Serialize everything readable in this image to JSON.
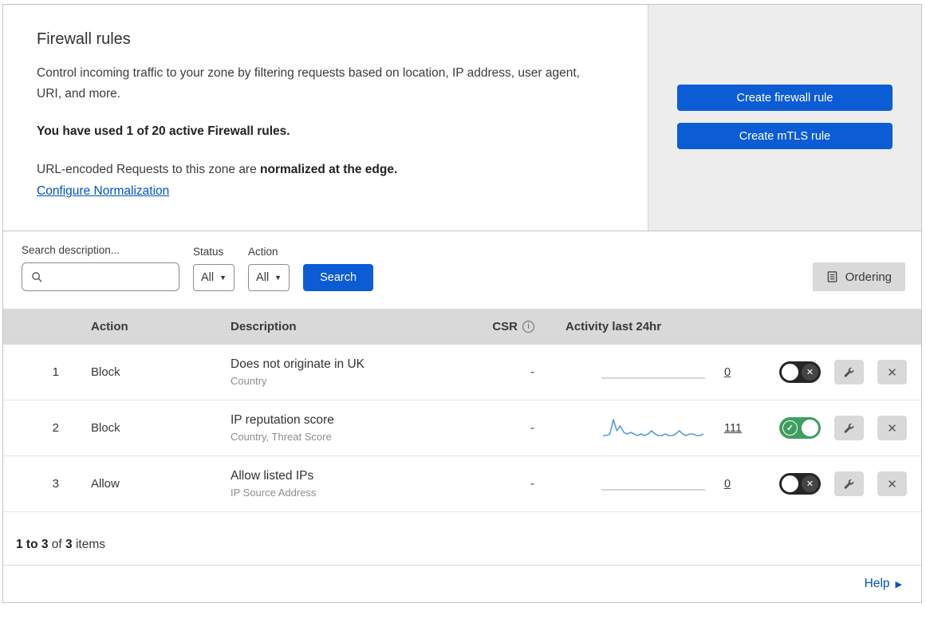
{
  "header": {
    "title": "Firewall rules",
    "description": "Control incoming traffic to your zone by filtering requests based on location, IP address, user agent, URI, and more.",
    "usage": "You have used 1 of 20 active Firewall rules.",
    "normalization_prefix": "URL-encoded Requests to this zone are ",
    "normalization_bold": "normalized at the edge.",
    "normalization_link": "Configure Normalization",
    "buttons": {
      "create_firewall": "Create firewall rule",
      "create_mtls": "Create mTLS rule"
    }
  },
  "filters": {
    "search_label": "Search description...",
    "status_label": "Status",
    "status_value": "All",
    "action_label": "Action",
    "action_value": "All",
    "search_button": "Search",
    "ordering_button": "Ordering"
  },
  "table": {
    "headers": {
      "action": "Action",
      "description": "Description",
      "csr": "CSR",
      "activity": "Activity last 24hr"
    },
    "rows": [
      {
        "index": "1",
        "action": "Block",
        "description": "Does not originate in UK",
        "subtitle": "Country",
        "csr": "-",
        "activity_count": "0",
        "enabled": false
      },
      {
        "index": "2",
        "action": "Block",
        "description": "IP reputation score",
        "subtitle": "Country, Threat Score",
        "csr": "-",
        "activity_count": "111",
        "enabled": true,
        "sparkline": [
          2,
          2,
          3,
          12,
          5,
          8,
          4,
          3,
          4,
          3,
          2,
          3,
          2,
          3,
          5,
          3,
          2,
          2,
          3,
          2,
          2,
          3,
          5,
          3,
          2,
          3,
          3,
          2,
          2,
          3
        ]
      },
      {
        "index": "3",
        "action": "Allow",
        "description": "Allow listed IPs",
        "subtitle": "IP Source Address",
        "csr": "-",
        "activity_count": "0",
        "enabled": false
      }
    ]
  },
  "footer": {
    "range": "1 to 3",
    "of": "of",
    "total": "3",
    "items": "items",
    "help": "Help"
  },
  "colors": {
    "accent_blue": "#0b5cd5",
    "link_blue": "#0051c3",
    "toggle_on_green": "#3f9e5f",
    "toggle_off_dark": "#262626",
    "panel_gray": "#ededed",
    "table_header_gray": "#d9d9d9",
    "sparkline_blue": "#5a9fd4"
  }
}
